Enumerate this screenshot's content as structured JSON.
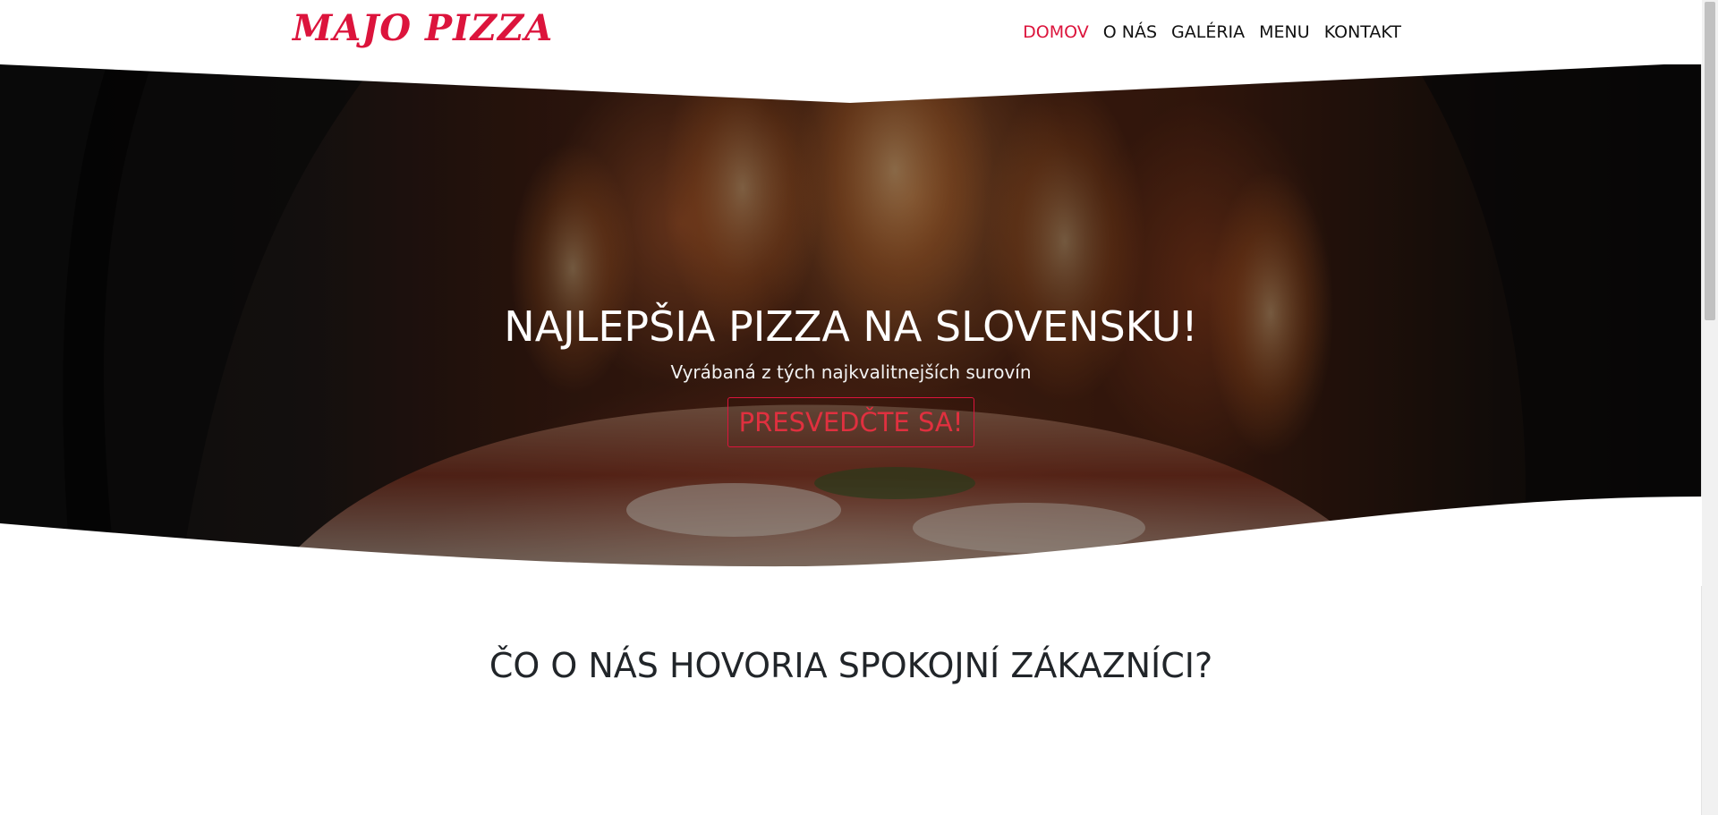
{
  "header": {
    "logo": "MAJO PIZZA",
    "nav": [
      {
        "label": "DOMOV",
        "active": true
      },
      {
        "label": "O NÁS",
        "active": false
      },
      {
        "label": "GALÉRIA",
        "active": false
      },
      {
        "label": "MENU",
        "active": false
      },
      {
        "label": "KONTAKT",
        "active": false
      }
    ]
  },
  "hero": {
    "title": "NAJLEPŠIA PIZZA NA SLOVENSKU!",
    "subtitle": "Vyrábaná z tých najkvalitnejších surovín",
    "cta_label": "PRESVEDČTE SA!"
  },
  "testimonials": {
    "title": "ČO O NÁS HOVORIA SPOKOJNÍ ZÁKAZNÍCI?"
  },
  "colors": {
    "accent": "#dc143c",
    "text": "#212529",
    "hero_text": "#ffffff"
  }
}
